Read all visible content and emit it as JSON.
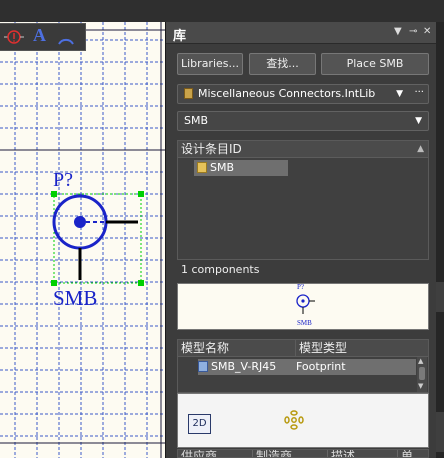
{
  "panel": {
    "title": "库",
    "header_controls": [
      "▼",
      "⊸",
      "✕"
    ],
    "buttons": {
      "libraries": "Libraries...",
      "search": "查找...",
      "place": "Place SMB"
    },
    "library_dropdown": {
      "value": "Miscellaneous Connectors.IntLib",
      "more": "···"
    },
    "filter_dropdown": {
      "value": "SMB"
    },
    "components_list": {
      "header": "设计条目ID",
      "items": [
        {
          "label": "SMB",
          "selected": true
        }
      ]
    },
    "count_text": "1 components",
    "symbol_preview": {
      "designator": "P?",
      "name": "SMB"
    },
    "models_table": {
      "headers": [
        "模型名称",
        "模型类型"
      ],
      "rows": [
        {
          "name": "SMB_V-RJ45",
          "type": "Footprint"
        }
      ]
    },
    "footprint_preview": {
      "mode_button": "2D"
    },
    "supplier_table": {
      "headers": [
        "供应商",
        "制造商",
        "描述",
        "单"
      ]
    }
  },
  "schematic": {
    "designator": "P?",
    "comment": "SMB",
    "colors": {
      "wire": "#1a24c8",
      "grid": "#2a49c8",
      "handle": "#00d000",
      "background": "#fdfbf2"
    }
  },
  "toolbar": {
    "icons": [
      "probe-icon",
      "text-icon",
      "arc-icon"
    ],
    "text_glyph": "A"
  }
}
